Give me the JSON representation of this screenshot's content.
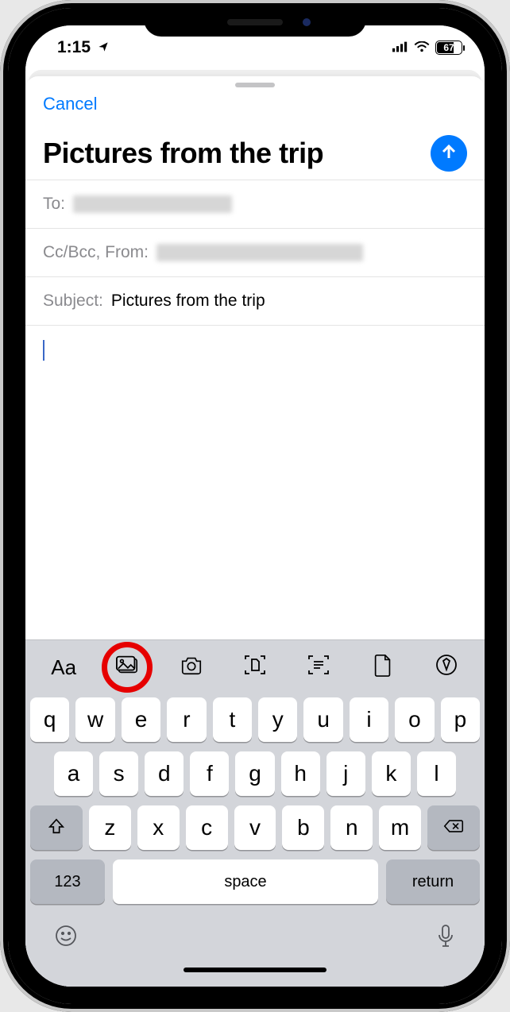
{
  "status": {
    "time": "1:15",
    "battery_pct": "67"
  },
  "nav": {
    "cancel": "Cancel"
  },
  "compose": {
    "title": "Pictures from the trip",
    "to_label": "To:",
    "cc_label": "Cc/Bcc, From:",
    "subject_label": "Subject:",
    "subject_value": "Pictures from the trip"
  },
  "accessory": {
    "format": "Aa"
  },
  "keyboard": {
    "row1": [
      "q",
      "w",
      "e",
      "r",
      "t",
      "y",
      "u",
      "i",
      "o",
      "p"
    ],
    "row2": [
      "a",
      "s",
      "d",
      "f",
      "g",
      "h",
      "j",
      "k",
      "l"
    ],
    "row3": [
      "z",
      "x",
      "c",
      "v",
      "b",
      "n",
      "m"
    ],
    "numbers": "123",
    "space": "space",
    "return": "return"
  }
}
